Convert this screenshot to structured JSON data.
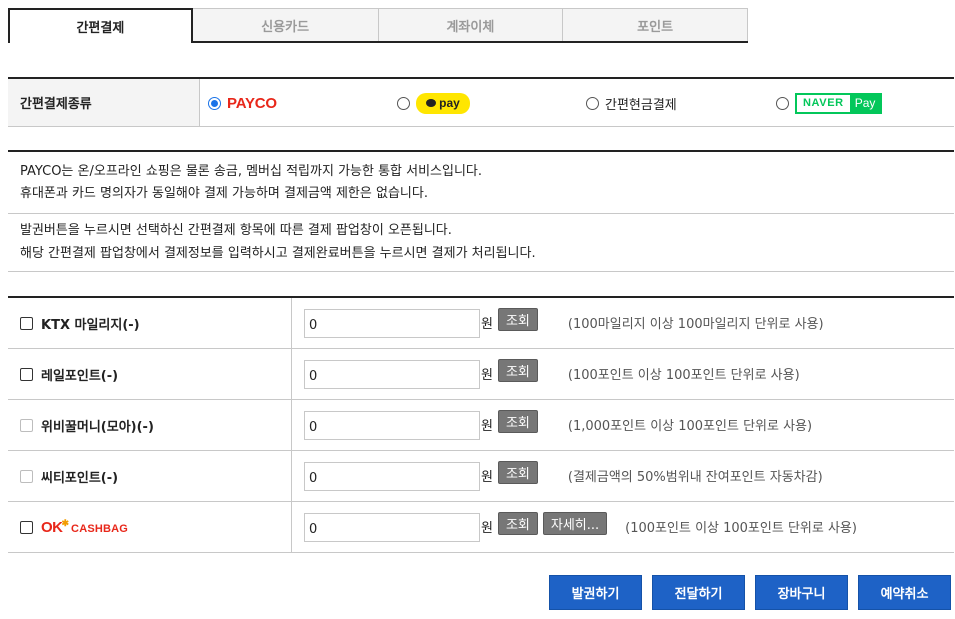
{
  "tabs": [
    {
      "label": "간편결제",
      "active": true
    },
    {
      "label": "신용카드",
      "active": false
    },
    {
      "label": "계좌이체",
      "active": false
    },
    {
      "label": "포인트",
      "active": false
    }
  ],
  "paytype": {
    "label": "간편결제종류",
    "options": [
      {
        "name": "PAYCO",
        "selected": true
      },
      {
        "name": "pay",
        "selected": false
      },
      {
        "name": "간편현금결제",
        "selected": false
      },
      {
        "name": "NAVER",
        "name2": "Pay",
        "selected": false
      }
    ]
  },
  "info": {
    "line1": "PAYCO는 온/오프라인 쇼핑은 물론 송금, 멤버십 적립까지 가능한 통합 서비스입니다.",
    "line2": "휴대폰과 카드 명의자가 동일해야 결제 가능하며 결제금액 제한은 없습니다.",
    "line3": "발권버튼을 누르시면 선택하신 간편결제 항목에 따른 결제 팝업창이 오픈됩니다.",
    "line4": "해당 간편결제 팝업창에서 결제정보를 입력하시고 결제완료버튼을 누르시면 결제가 처리됩니다."
  },
  "points": {
    "won": "원",
    "query_label": "조회",
    "detail_label": "자세히...",
    "rows": [
      {
        "label": "KTX 마일리지(-)",
        "value": "0",
        "hint": "(100마일리지 이상 100마일리지 단위로 사용)",
        "enabled": true
      },
      {
        "label": "레일포인트(-)",
        "value": "0",
        "hint": "(100포인트 이상 100포인트 단위로 사용)",
        "enabled": true
      },
      {
        "label": "위비꿀머니(모아)(-)",
        "value": "0",
        "hint": "(1,000포인트 이상 100포인트 단위로 사용)",
        "enabled": false
      },
      {
        "label": "씨티포인트(-)",
        "value": "0",
        "hint": "(결제금액의 50%범위내 잔여포인트 자동차감)",
        "enabled": false
      },
      {
        "label_ok": "OK",
        "label_cashbag": "CASHBAG",
        "value": "0",
        "hint": "(100포인트 이상 100포인트 단위로 사용)",
        "enabled": true
      }
    ]
  },
  "actions": {
    "issue": "발권하기",
    "forward": "전달하기",
    "cart": "장바구니",
    "cancel": "예약취소"
  },
  "colors": {
    "accent_blue": "#1e62c6",
    "payco_red": "#e8271a",
    "kakao_yellow": "#ffe600",
    "naver_green": "#03c75a"
  }
}
